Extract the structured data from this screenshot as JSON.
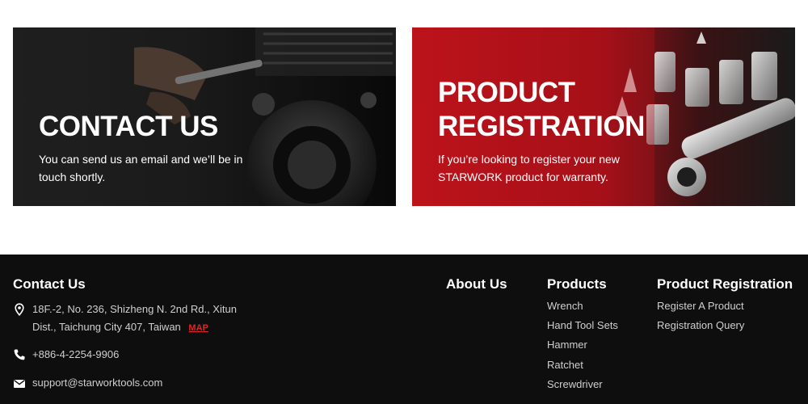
{
  "cards": {
    "contact": {
      "title": "CONTACT US",
      "description": "You can send us an email and we’ll be in touch shortly."
    },
    "register": {
      "title": "PRODUCT REGISTRATION",
      "description": "If you’re looking to register your new STARWORK product for warranty."
    }
  },
  "footer": {
    "contact": {
      "heading": "Contact Us",
      "address": "18F.-2, No. 236, Shizheng N. 2nd Rd., Xitun Dist., Taichung City 407, Taiwan",
      "map_label": "MAP",
      "phone": "+886-4-2254-9906",
      "email": "support@starworktools.com"
    },
    "about": {
      "heading": "About Us"
    },
    "products": {
      "heading": "Products",
      "items": [
        "Wrench",
        "Hand Tool Sets",
        "Hammer",
        "Ratchet",
        "Screwdriver"
      ]
    },
    "registration": {
      "heading": "Product Registration",
      "items": [
        "Register A Product",
        "Registration Query"
      ]
    }
  },
  "icons": {
    "address": "map-pin-icon",
    "phone": "phone-icon",
    "email": "envelope-icon"
  },
  "colors": {
    "footer_bg": "#0e0e0e",
    "register_red": "#b8121b",
    "map_link": "#e02424"
  }
}
